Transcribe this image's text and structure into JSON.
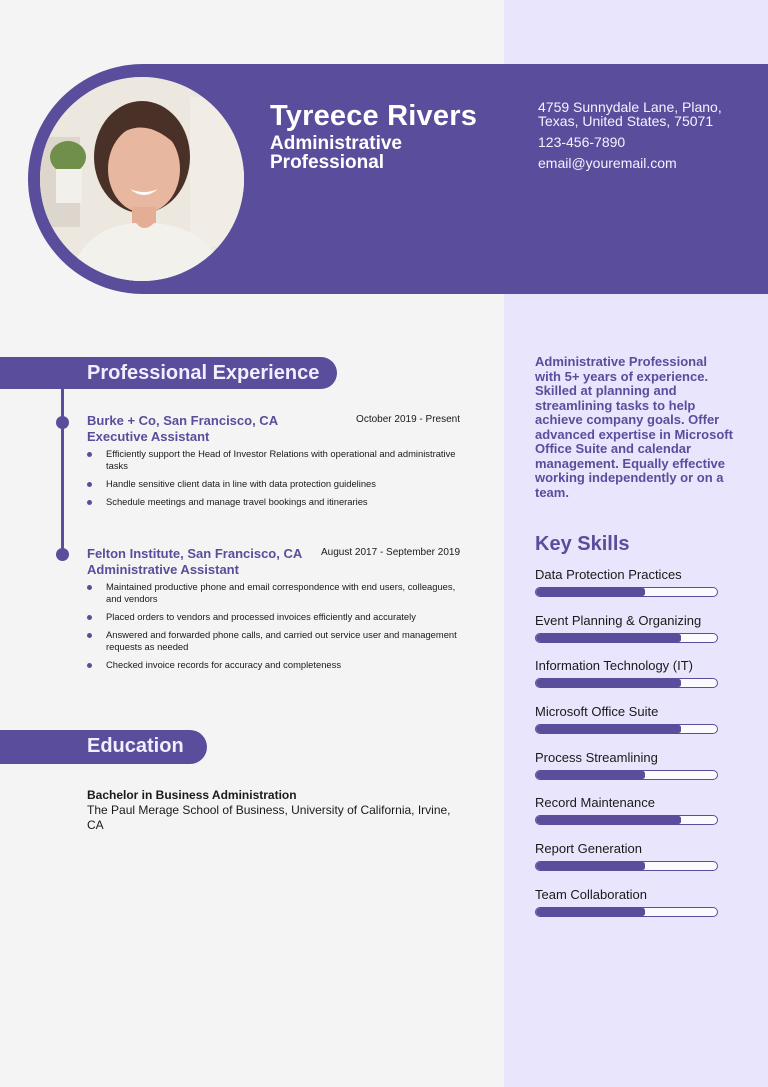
{
  "header": {
    "name": "Tyreece Rivers",
    "title": "Administrative Professional",
    "photo_alt": "profile-photo",
    "contact": {
      "address": "4759 Sunnydale Lane, Plano, Texas, United States, 75071",
      "phone": "123-456-7890",
      "email": "email@youremail.com"
    }
  },
  "experience": {
    "heading": "Professional Experience",
    "jobs": [
      {
        "company": "Burke + Co, San Francisco, CA",
        "role": "Executive Assistant",
        "dates": "October 2019 - Present",
        "bullets": [
          "Efficiently support the Head of Investor Relations with operational and administrative tasks",
          "Handle sensitive client data in line with data protection guidelines",
          "Schedule meetings and manage travel bookings and itineraries"
        ]
      },
      {
        "company": "Felton Institute, San Francisco, CA",
        "role": "Administrative Assistant",
        "dates": "August 2017 - September 2019",
        "bullets": [
          "Maintained productive phone and email correspondence with end users, colleagues, and vendors",
          "Placed orders to vendors and processed invoices efficiently and accurately",
          "Answered and forwarded phone calls, and carried out service user and management requests as needed",
          "Checked invoice records for accuracy and completeness"
        ]
      }
    ]
  },
  "education": {
    "heading": "Education",
    "degree": "Bachelor in Business Administration",
    "school": "The Paul Merage School of Business, University of California, Irvine, CA"
  },
  "summary": "Administrative Professional with 5+ years of experience. Skilled  at planning and streamlining tasks to help achieve company goals. Offer  advanced expertise in Microsoft Office Suite and calendar management.  Equally effective working independently or on a team.",
  "skills": {
    "heading": "Key Skills",
    "items": [
      {
        "label": "Data Protection Practices",
        "level": 0.6
      },
      {
        "label": "Event Planning & Organizing",
        "level": 0.8
      },
      {
        "label": "Information Technology (IT)",
        "level": 0.8
      },
      {
        "label": "Microsoft Office Suite",
        "level": 0.8
      },
      {
        "label": "Process Streamlining",
        "level": 0.6
      },
      {
        "label": "Record Maintenance",
        "level": 0.8
      },
      {
        "label": "Report Generation",
        "level": 0.6
      },
      {
        "label": "Team Collaboration",
        "level": 0.6
      }
    ]
  },
  "colors": {
    "accent": "#5a4e9c",
    "sidebar_bg": "#e9e5fc",
    "page_bg": "#f4f4f4"
  }
}
